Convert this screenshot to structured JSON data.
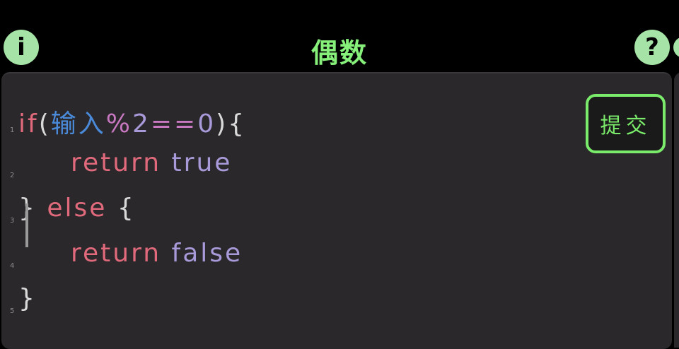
{
  "header": {
    "title": "偶数",
    "info_label": "i",
    "help_label": "?"
  },
  "editor": {
    "submit_label": "提交",
    "lines": [
      {
        "number": "1",
        "tokens": [
          {
            "text": "if",
            "kind": "kw"
          },
          {
            "text": "(",
            "kind": "paren"
          },
          {
            "text": "输入",
            "kind": "ident"
          },
          {
            "text": "%",
            "kind": "op"
          },
          {
            "text": "2",
            "kind": "num"
          },
          {
            "text": "==",
            "kind": "op"
          },
          {
            "text": "0",
            "kind": "num"
          },
          {
            "text": "){",
            "kind": "paren"
          }
        ]
      },
      {
        "number": "2",
        "indent": true,
        "tokens": [
          {
            "text": "return",
            "kind": "kw"
          },
          {
            "text": " ",
            "kind": "paren"
          },
          {
            "text": "true",
            "kind": "val"
          }
        ]
      },
      {
        "number": "3",
        "tokens": [
          {
            "text": "}",
            "kind": "paren"
          },
          {
            "text": " else ",
            "kind": "kw"
          },
          {
            "text": "{",
            "kind": "paren"
          }
        ]
      },
      {
        "number": "4",
        "indent": true,
        "tokens": [
          {
            "text": "return",
            "kind": "kw"
          },
          {
            "text": " ",
            "kind": "paren"
          },
          {
            "text": "false",
            "kind": "val"
          }
        ]
      },
      {
        "number": "5",
        "tokens": [
          {
            "text": "}",
            "kind": "paren"
          }
        ]
      }
    ]
  },
  "colors": {
    "title": "#86f07a",
    "keyword": "#e06a7b",
    "identifier": "#4a8ad8",
    "value": "#a89ad8",
    "button_bg": "#a6e3a6",
    "editor_bg": "#2a282b"
  },
  "icons": {
    "info": "info-icon",
    "help": "help-icon"
  }
}
